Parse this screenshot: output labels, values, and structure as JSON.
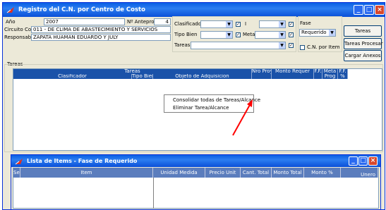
{
  "window": {
    "title": "Registro del C.N. por Centro de Costo"
  },
  "form": {
    "year_label": "Año",
    "year_value": "2007",
    "nro_label": "Nº Anteproy",
    "nro_value": "4",
    "circuito_label": "Circuito Costos",
    "circuito_value": "011 - DE CLIMA DE ABASTECIMIENTO Y SERVICIOS",
    "responsable_label": "Responsable",
    "responsable_value": "ZAPATA HUAMAN EDUARDO Y JULY",
    "clasificador_label": "Clasificador",
    "tipo_bien_label": "Tipo Bien",
    "tareas_label": "Tareas",
    "combo2_label": "I",
    "meta_label": "Meta",
    "fase_label": "Fase",
    "fase_value": "Requerido",
    "cn_por_item_label": "C.N. por Item"
  },
  "buttons": {
    "tareas": "Tareas",
    "tareas_procesar": "Tareas Procesar",
    "cargar_anexos": "Cargar Anexos"
  },
  "tareas_section": {
    "label": "Tareas",
    "headers": [
      "Clasificador",
      "Tipo Bien",
      "Tareas",
      "Objeto de Adquisicion",
      "Nro Proy",
      "Monto Requer",
      "F.F.",
      "Meta Prog",
      "F.F. %"
    ]
  },
  "context_menu": {
    "items": [
      "Consolidar todas de Tareas/Alcance",
      "Eliminar Tarea/Alcance"
    ]
  },
  "subwindow": {
    "title": "Lista de Items - Fase de Requerido",
    "headers": [
      "Sec",
      "Item",
      "Unidad Medida",
      "Precio Unit",
      "Cant. Total",
      "Monto Total",
      "Monto %",
      "Unero"
    ]
  },
  "colors": {
    "titlebar": "#0a5fe4",
    "grid_header": "#1a52a9",
    "annotation_arrow": "#ff0000"
  }
}
